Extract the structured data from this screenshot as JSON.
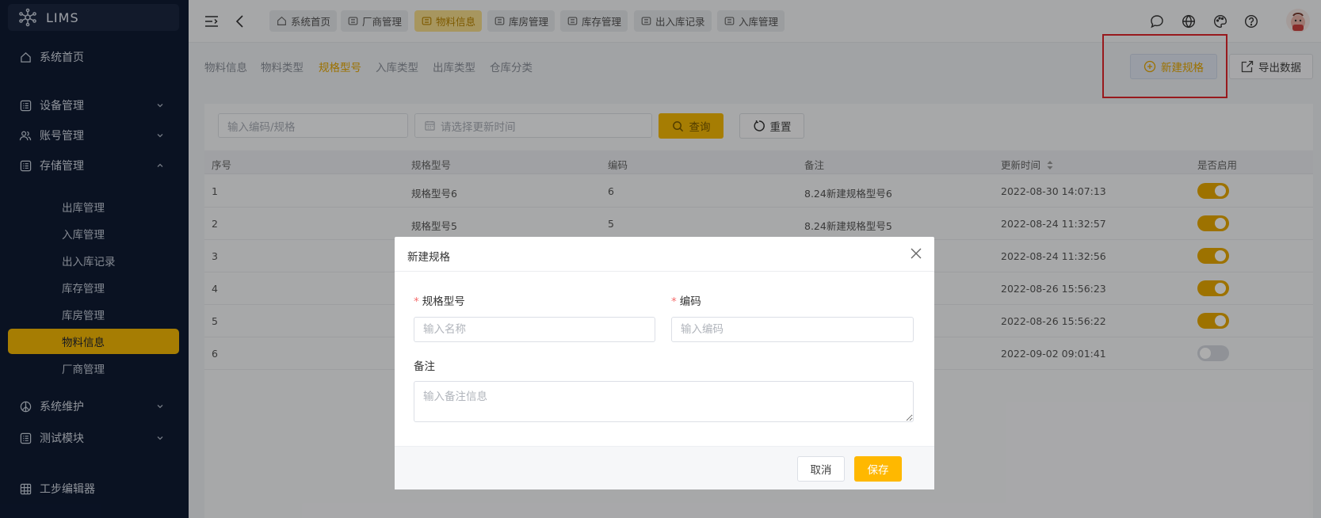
{
  "app": {
    "name": "LIMS"
  },
  "sidebar": {
    "home": "系统首页",
    "device": "设备管理",
    "account": "账号管理",
    "storage": "存储管理",
    "storage_children": [
      "出库管理",
      "入库管理",
      "出入库记录",
      "库存管理",
      "库房管理",
      "物料信息",
      "厂商管理"
    ],
    "maintenance": "系统维护",
    "test": "测试模块",
    "editor": "工步编辑器"
  },
  "tags": [
    "系统首页",
    "厂商管理",
    "物料信息",
    "库房管理",
    "库存管理",
    "出入库记录",
    "入库管理"
  ],
  "subtabs": [
    "物料信息",
    "物料类型",
    "规格型号",
    "入库类型",
    "出库类型",
    "仓库分类"
  ],
  "actions": {
    "new_spec": "新建规格",
    "export": "导出数据"
  },
  "filters": {
    "code_placeholder": "输入编码/规格",
    "date_placeholder": "请选择更新时间",
    "query": "查询",
    "reset": "重置"
  },
  "table": {
    "headers": [
      "序号",
      "规格型号",
      "编码",
      "备注",
      "更新时间",
      "是否启用"
    ],
    "rows": [
      {
        "no": "1",
        "spec": "规格型号6",
        "code": "6",
        "note": "8.24新建规格型号6",
        "time": "2022-08-30 14:07:13",
        "enabled": true
      },
      {
        "no": "2",
        "spec": "规格型号5",
        "code": "5",
        "note": "8.24新建规格型号5",
        "time": "2022-08-24 11:32:57",
        "enabled": true
      },
      {
        "no": "3",
        "spec": "",
        "code": "",
        "note": "",
        "time": "2022-08-24 11:32:56",
        "enabled": true
      },
      {
        "no": "4",
        "spec": "",
        "code": "",
        "note": "",
        "time": "2022-08-26 15:56:23",
        "enabled": true
      },
      {
        "no": "5",
        "spec": "",
        "code": "",
        "note": "",
        "time": "2022-08-26 15:56:22",
        "enabled": true
      },
      {
        "no": "6",
        "spec": "",
        "code": "",
        "note": "",
        "time": "2022-09-02 09:01:41",
        "enabled": false
      }
    ]
  },
  "dialog": {
    "title": "新建规格",
    "spec_label": "规格型号",
    "spec_placeholder": "输入名称",
    "code_label": "编码",
    "code_placeholder": "输入编码",
    "note_label": "备注",
    "note_placeholder": "输入备注信息",
    "cancel": "取消",
    "save": "保存"
  },
  "colors": {
    "accent": "#f5b905",
    "sidebar_bg": "#0f1b33",
    "highlight_box": "#e0252b"
  }
}
